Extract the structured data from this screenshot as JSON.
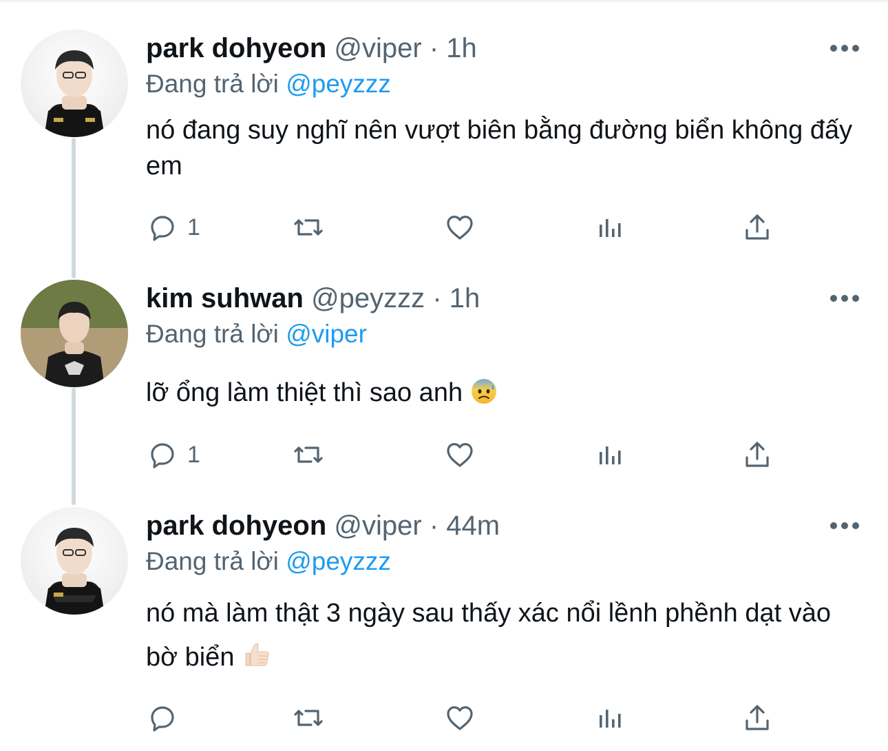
{
  "tweets": [
    {
      "name": "park dohyeon",
      "handle": "@viper",
      "separator": "·",
      "time": "1h",
      "replying_label": "Đang trả lời",
      "replying_to": "@peyzzz",
      "text": "nó đang suy nghĩ nên vượt biên bằng đường biển không đấy em",
      "reply_count": "1",
      "avatar_icon": "player-avatar"
    },
    {
      "name": "kim suhwan",
      "handle": "@peyzzz",
      "separator": "·",
      "time": "1h",
      "replying_label": "Đang trả lời",
      "replying_to": "@viper",
      "text": "lỡ ổng làm thiệt thì sao anh",
      "reply_count": "1",
      "avatar_icon": "player-avatar",
      "emoji": "anxious-face-with-sweat"
    },
    {
      "name": "park dohyeon",
      "handle": "@viper",
      "separator": "·",
      "time": "44m",
      "replying_label": "Đang trả lời",
      "replying_to": "@peyzzz",
      "text": "nó mà làm thật 3 ngày sau thấy xác nổi lềnh phềnh dạt vào bờ biển",
      "reply_count": "",
      "avatar_icon": "player-avatar",
      "emoji": "thumbs-up-light-skin"
    }
  ],
  "colors": {
    "text": "#0f1419",
    "secondary": "#536471",
    "mention": "#1d9bf0",
    "thread_line": "#cfd9de"
  }
}
